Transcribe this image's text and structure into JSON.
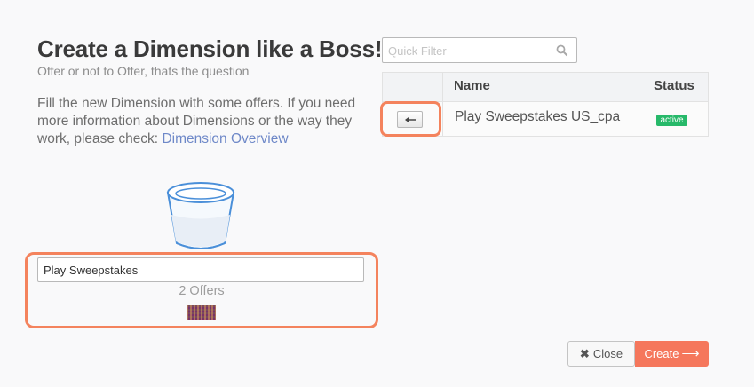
{
  "header": {
    "title": "Create a Dimension like a Boss!",
    "subtitle": "Offer or not to Offer, thats the question"
  },
  "intro": {
    "text": "Fill the new Dimension with some offers. If you need more information about Dimensions or the way they work, please check: ",
    "link_label": "Dimension Overview"
  },
  "dimension": {
    "name_value": "Play Sweepstakes",
    "offer_count": "2 Offers",
    "icon": "bucket-icon"
  },
  "filter": {
    "placeholder": "Quick Filter",
    "icon": "search-icon"
  },
  "table": {
    "columns": [
      "Name",
      "Status"
    ],
    "rows": [
      {
        "action": "arrow-left-icon",
        "name": "Play Sweepstakes US_cpa",
        "status": "active"
      }
    ]
  },
  "footer": {
    "close_label": "Close",
    "create_label": "Create"
  },
  "colors": {
    "accent": "#f5775c",
    "highlight": "#f4835d",
    "status_active": "#27b96a",
    "link": "#6e88c8"
  }
}
